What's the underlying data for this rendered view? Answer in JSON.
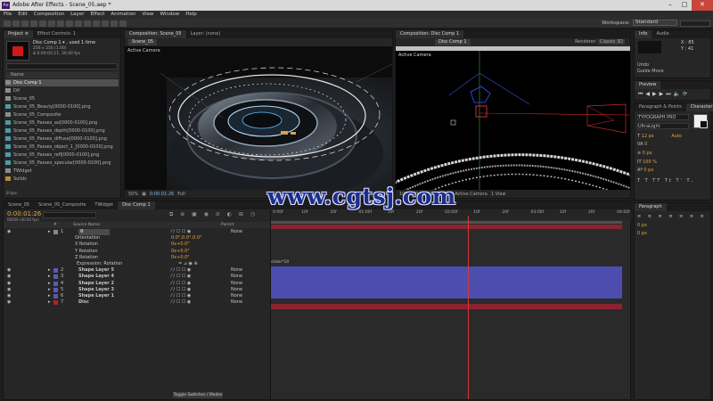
{
  "window": {
    "title": "Adobe After Effects - Scene_05.aep *",
    "app_icon_label": "Ae",
    "controls": [
      "–",
      "□",
      "✕"
    ]
  },
  "menu": [
    "File",
    "Edit",
    "Composition",
    "Layer",
    "Effect",
    "Animation",
    "View",
    "Window",
    "Help"
  ],
  "toolbar": {
    "workspace_label": "Workspace:",
    "workspace_value": "Standard"
  },
  "project_panel": {
    "tabs": [
      "Project ≡",
      "Effect Controls: 1"
    ],
    "selected_name": "Disc Comp 1 ▾ , used 1 time",
    "selected_info": [
      "256 x 256 (1.00)",
      "Δ 0:00:05:11, 30.00 fps"
    ],
    "column_name": "Name",
    "items": [
      {
        "label": "Disc Comp 1",
        "type": "comp",
        "selected": true
      },
      {
        "label": "Dif",
        "type": "comp"
      },
      {
        "label": "Scene_05",
        "type": "comp"
      },
      {
        "label": "Scene_05_Beauty[0000-0100].png",
        "type": "seq"
      },
      {
        "label": "Scene_05_Composite",
        "type": "comp"
      },
      {
        "label": "Scene_05_Passes_ao[0000-0100].png",
        "type": "seq"
      },
      {
        "label": "Scene_05_Passes_depth[0000-0100].png",
        "type": "seq"
      },
      {
        "label": "Scene_05_Passes_diffuse[0000-0100].png",
        "type": "seq"
      },
      {
        "label": "Scene_05_Passes_object_1_[0000-0100].png",
        "type": "seq"
      },
      {
        "label": "Scene_05_Passes_refl[0000-0100].png",
        "type": "seq"
      },
      {
        "label": "Scene_05_Passes_specular[0000-0100].png",
        "type": "seq"
      },
      {
        "label": "TWidget",
        "type": "comp"
      },
      {
        "label": "Solids",
        "type": "folder"
      }
    ],
    "footer": "8 bpc"
  },
  "left_viewer": {
    "tabs": [
      "Composition: Scene_05",
      "Layer: (none)"
    ],
    "comp_tab": "Scene_05",
    "label": "Active Camera",
    "zoom": "50%",
    "timecode": "0:00:01:26",
    "quality": "Full"
  },
  "right_viewer": {
    "tab": "Composition: Disc Comp 1",
    "comp_tab": "Disc Comp 1",
    "renderer_label": "Renderer:",
    "renderer": "Classic 3D",
    "label": "Active Camera",
    "zoom": "100%",
    "timecode": "0:00:01:26",
    "quality": "Full",
    "camera": "Active Camera",
    "views": "1 View"
  },
  "info_panel": {
    "tabs": [
      "Info",
      "Audio"
    ],
    "x": "X : 85",
    "y": "Y : 41",
    "undo": "Undo",
    "action": "Guide Move",
    "preview_tab": "Preview",
    "char_tabs": [
      "Paragraph & Points",
      "Character"
    ],
    "font": "TYPOGRAPH PRO",
    "style": "UltraLight",
    "size": "12 px",
    "leading": "Auto",
    "tracking": "0",
    "scale": "100 %",
    "baseline": "0 px",
    "paragraph_tab": "Paragraph"
  },
  "timeline": {
    "tabs": [
      "Scene_05",
      "Scene_05_Composite",
      "TWidget",
      "Disc Comp 1"
    ],
    "timecode": "0:00:01:26",
    "frame_info": "00056 (30.00 fps)",
    "columns": {
      "num": "#",
      "source": "Source Name",
      "parent": "Parent"
    },
    "layers": [
      {
        "kind": "layer",
        "num": "1",
        "name": "0",
        "parent": "None"
      },
      {
        "kind": "prop",
        "name": "Orientation",
        "value": "0.0°,0.0°,0.0°"
      },
      {
        "kind": "prop",
        "name": "X Rotation",
        "value": "0x+0.0°"
      },
      {
        "kind": "prop",
        "name": "Y Rotation",
        "value": "0x+0.0°"
      },
      {
        "kind": "prop",
        "name": "Z Rotation",
        "value": "0x+0.0°"
      },
      {
        "kind": "expr",
        "name": "Expression: Rotation"
      },
      {
        "kind": "layer",
        "num": "2",
        "name": "Shape Layer 5",
        "parent": "None",
        "color": "#5a5ab4"
      },
      {
        "kind": "layer",
        "num": "3",
        "name": "Shape Layer 4",
        "parent": "None",
        "color": "#5a5ab4"
      },
      {
        "kind": "layer",
        "num": "4",
        "name": "Shape Layer 2",
        "parent": "None",
        "color": "#5a5ab4"
      },
      {
        "kind": "layer",
        "num": "5",
        "name": "Shape Layer 3",
        "parent": "None",
        "color": "#5a5ab4"
      },
      {
        "kind": "layer",
        "num": "6",
        "name": "Shape Layer 1",
        "parent": "None",
        "color": "#5a5ab4"
      },
      {
        "kind": "layer",
        "num": "7",
        "name": "Disc",
        "parent": "None",
        "color": "#b52020"
      }
    ],
    "ruler": [
      "0:00f",
      "10f",
      "20f",
      "01:00f",
      "10f",
      "20f",
      "02:00f",
      "10f",
      "20f",
      "03:00f",
      "10f",
      "20f",
      "04:00f"
    ],
    "playhead": 0.56,
    "expression_text": "slider*10",
    "footer_toggle": "Toggle Switches / Modes"
  },
  "colors": {
    "layer_blue": "#5a5ab4",
    "layer_red": "#b52020",
    "playhead": "#d23a3a",
    "timecode": "#e8a43c"
  },
  "watermark": "www.cgtsj.com"
}
